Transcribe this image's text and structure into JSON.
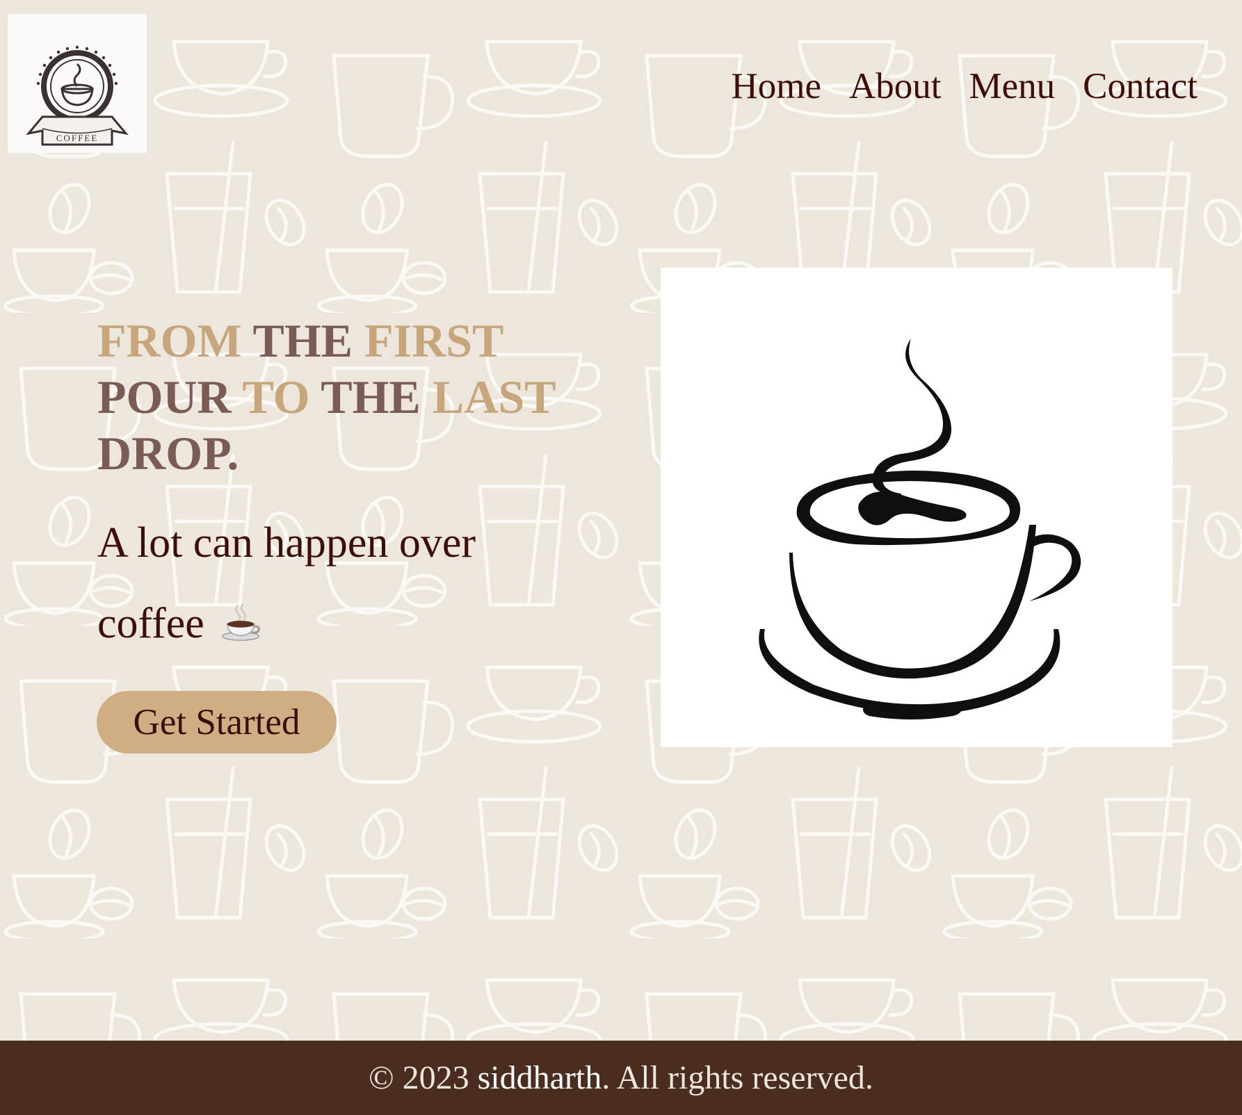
{
  "brand": {
    "logo_text": "COFFEE",
    "logo_icon": "coffee-badge-logo"
  },
  "nav": {
    "items": [
      {
        "label": "Home"
      },
      {
        "label": "About"
      },
      {
        "label": "Menu"
      },
      {
        "label": "Contact"
      }
    ]
  },
  "hero": {
    "headline_words": [
      {
        "text": "FROM",
        "tone": "light"
      },
      {
        "text": "THE",
        "tone": "dark"
      },
      {
        "text": "FIRST",
        "tone": "light"
      },
      {
        "text": "POUR",
        "tone": "dark"
      },
      {
        "text": "TO",
        "tone": "light"
      },
      {
        "text": "THE",
        "tone": "dark"
      },
      {
        "text": "LAST",
        "tone": "light"
      },
      {
        "text": "DROP.",
        "tone": "dark"
      }
    ],
    "tagline": "A lot can happen over coffee",
    "tagline_icon": "hot-beverage-emoji",
    "cta_label": "Get Started",
    "illustration_icon": "coffee-cup-icon"
  },
  "footer": {
    "copyright_prefix": "© 2023",
    "author": "siddharth",
    "copyright_suffix": ". All rights reserved."
  },
  "colors": {
    "background": "#ede6dc",
    "accent_light": "#c7a67c",
    "accent_dark": "#7b5c55",
    "text": "#3d0e08",
    "button": "#d0ae84",
    "footer_bg": "#4a2d1f"
  }
}
